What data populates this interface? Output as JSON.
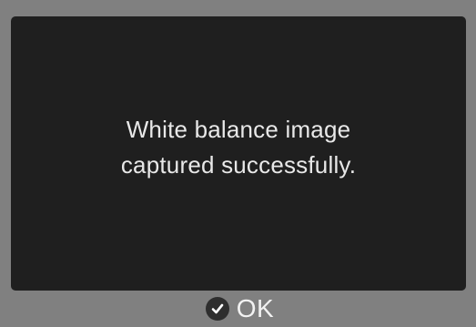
{
  "dialog": {
    "message_line1": "White balance image",
    "message_line2": "captured successfully."
  },
  "footer": {
    "ok_icon": "check-icon",
    "ok_label": "OK"
  },
  "colors": {
    "background": "#808080",
    "panel": "#1f1f1f",
    "text": "#e8e8e8"
  }
}
